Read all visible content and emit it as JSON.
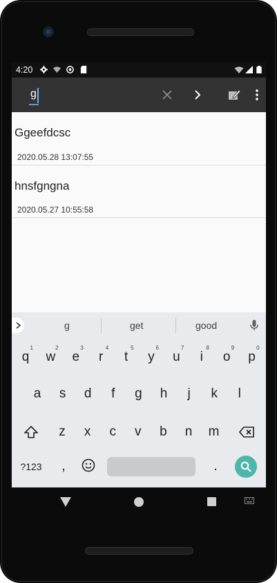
{
  "status": {
    "time": "4:20"
  },
  "search": {
    "query": "g"
  },
  "notes": [
    {
      "title": "Ggeefdcsc",
      "date": "2020.05.28 13:07:55"
    },
    {
      "title": "hnsfgngna",
      "date": "2020.05.27 10:55:58"
    }
  ],
  "keyboard": {
    "suggestions": [
      "g",
      "get",
      "good"
    ],
    "row1": [
      {
        "k": "q",
        "n": "1"
      },
      {
        "k": "w",
        "n": "2"
      },
      {
        "k": "e",
        "n": "3"
      },
      {
        "k": "r",
        "n": "4"
      },
      {
        "k": "t",
        "n": "5"
      },
      {
        "k": "y",
        "n": "6"
      },
      {
        "k": "u",
        "n": "7"
      },
      {
        "k": "i",
        "n": "8"
      },
      {
        "k": "o",
        "n": "9"
      },
      {
        "k": "p",
        "n": "0"
      }
    ],
    "row2": [
      "a",
      "s",
      "d",
      "f",
      "g",
      "h",
      "j",
      "k",
      "l"
    ],
    "row3": [
      "z",
      "x",
      "c",
      "v",
      "b",
      "n",
      "m"
    ],
    "symbols_label": "?123",
    "comma": ",",
    "period": "."
  },
  "colors": {
    "appbar": "#333333",
    "accent": "#4db6ac",
    "keyboard_bg": "#e8eaed"
  }
}
